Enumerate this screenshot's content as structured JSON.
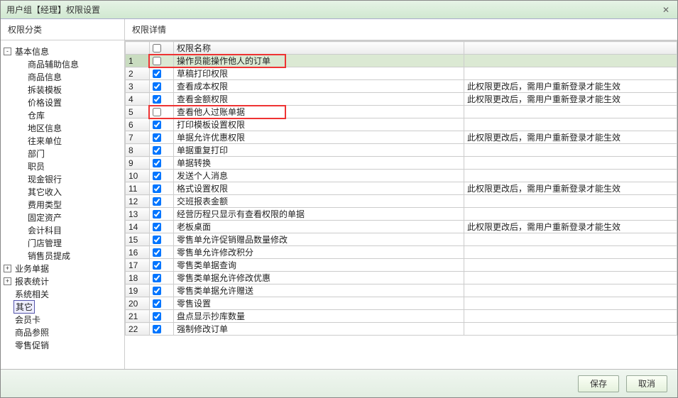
{
  "window": {
    "title": "用户组【经理】权限设置",
    "close_icon": "✕"
  },
  "left": {
    "header": "权限分类",
    "tree": [
      {
        "level": 0,
        "toggle": "-",
        "label": "基本信息"
      },
      {
        "level": 1,
        "label": "商品辅助信息"
      },
      {
        "level": 1,
        "label": "商品信息"
      },
      {
        "level": 1,
        "label": "拆装模板"
      },
      {
        "level": 1,
        "label": "价格设置"
      },
      {
        "level": 1,
        "label": "仓库"
      },
      {
        "level": 1,
        "label": "地区信息"
      },
      {
        "level": 1,
        "label": "往来单位"
      },
      {
        "level": 1,
        "label": "部门"
      },
      {
        "level": 1,
        "label": "职员"
      },
      {
        "level": 1,
        "label": "现金银行"
      },
      {
        "level": 1,
        "label": "其它收入"
      },
      {
        "level": 1,
        "label": "费用类型"
      },
      {
        "level": 1,
        "label": "固定资产"
      },
      {
        "level": 1,
        "label": "会计科目"
      },
      {
        "level": 1,
        "label": "门店管理"
      },
      {
        "level": 1,
        "label": "销售员提成"
      },
      {
        "level": 0,
        "toggle": "+",
        "label": "业务单据"
      },
      {
        "level": 0,
        "toggle": "+",
        "label": "报表统计"
      },
      {
        "level": 0,
        "label": "系统相关"
      },
      {
        "level": 0,
        "label": "其它",
        "selected": true
      },
      {
        "level": 0,
        "label": "会员卡"
      },
      {
        "level": 0,
        "label": "商品参照"
      },
      {
        "level": 0,
        "label": "零售促销"
      }
    ]
  },
  "right": {
    "header": "权限详情",
    "columns": {
      "name": "权限名称",
      "note": ""
    },
    "note_text": "此权限更改后，需用户重新登录才能生效",
    "rows": [
      {
        "n": 1,
        "checked": false,
        "name": "操作员能操作他人的订单",
        "note": false,
        "selected": true
      },
      {
        "n": 2,
        "checked": true,
        "name": "草稿打印权限",
        "note": false
      },
      {
        "n": 3,
        "checked": true,
        "name": "查看成本权限",
        "note": true
      },
      {
        "n": 4,
        "checked": true,
        "name": "查看金额权限",
        "note": true
      },
      {
        "n": 5,
        "checked": false,
        "name": "查看他人过账单据",
        "note": false
      },
      {
        "n": 6,
        "checked": true,
        "name": "打印模板设置权限",
        "note": false
      },
      {
        "n": 7,
        "checked": true,
        "name": "单据允许优惠权限",
        "note": true
      },
      {
        "n": 8,
        "checked": true,
        "name": "单据重复打印",
        "note": false
      },
      {
        "n": 9,
        "checked": true,
        "name": "单据转换",
        "note": false
      },
      {
        "n": 10,
        "checked": true,
        "name": "发送个人消息",
        "note": false
      },
      {
        "n": 11,
        "checked": true,
        "name": "格式设置权限",
        "note": true
      },
      {
        "n": 12,
        "checked": true,
        "name": "交班报表金额",
        "note": false
      },
      {
        "n": 13,
        "checked": true,
        "name": "经营历程只显示有查看权限的单据",
        "note": false
      },
      {
        "n": 14,
        "checked": true,
        "name": "老板桌面",
        "note": true
      },
      {
        "n": 15,
        "checked": true,
        "name": "零售单允许促销赠品数量修改",
        "note": false
      },
      {
        "n": 16,
        "checked": true,
        "name": "零售单允许修改积分",
        "note": false
      },
      {
        "n": 17,
        "checked": true,
        "name": "零售类单据查询",
        "note": false
      },
      {
        "n": 18,
        "checked": true,
        "name": "零售类单据允许修改优惠",
        "note": false
      },
      {
        "n": 19,
        "checked": true,
        "name": "零售类单据允许赠送",
        "note": false
      },
      {
        "n": 20,
        "checked": true,
        "name": "零售设置",
        "note": false
      },
      {
        "n": 21,
        "checked": true,
        "name": "盘点显示抄库数量",
        "note": false
      },
      {
        "n": 22,
        "checked": true,
        "name": "强制修改订单",
        "note": false
      }
    ]
  },
  "footer": {
    "save": "保存",
    "cancel": "取消"
  }
}
